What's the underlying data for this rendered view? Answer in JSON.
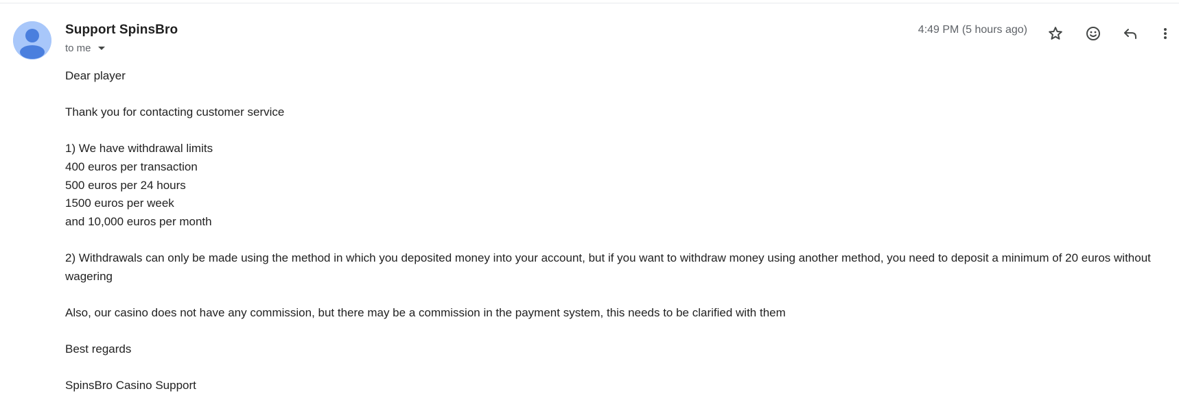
{
  "message": {
    "sender": {
      "name": "Support SpinsBro",
      "avatar_color": "#a8c7fa",
      "avatar_figure_color": "#4a7fde"
    },
    "recipient_label": "to me",
    "timestamp": "4:49 PM (5 hours ago)",
    "actions": [
      {
        "name": "star",
        "icon": "star-icon"
      },
      {
        "name": "react",
        "icon": "emoji-icon"
      },
      {
        "name": "reply",
        "icon": "reply-icon"
      },
      {
        "name": "more",
        "icon": "more-vert-icon"
      }
    ],
    "body": {
      "greeting": "Dear player",
      "thanks": "Thank you for contacting customer service",
      "limits": [
        "1) We have withdrawal limits",
        "400 euros per transaction",
        "500 euros per 24 hours",
        "1500 euros per week",
        "and 10,000 euros per month"
      ],
      "withdrawal_method": "2) Withdrawals can only be made using the method in which you deposited money into your account, but if you want to withdraw money using another method, you need to deposit a minimum of 20 euros without wagering",
      "commission": "Also, our casino does not have any commission, but there may be a commission in the payment system, this needs to be clarified with them",
      "closing": "Best regards",
      "signature": "SpinsBro Casino Support"
    }
  }
}
